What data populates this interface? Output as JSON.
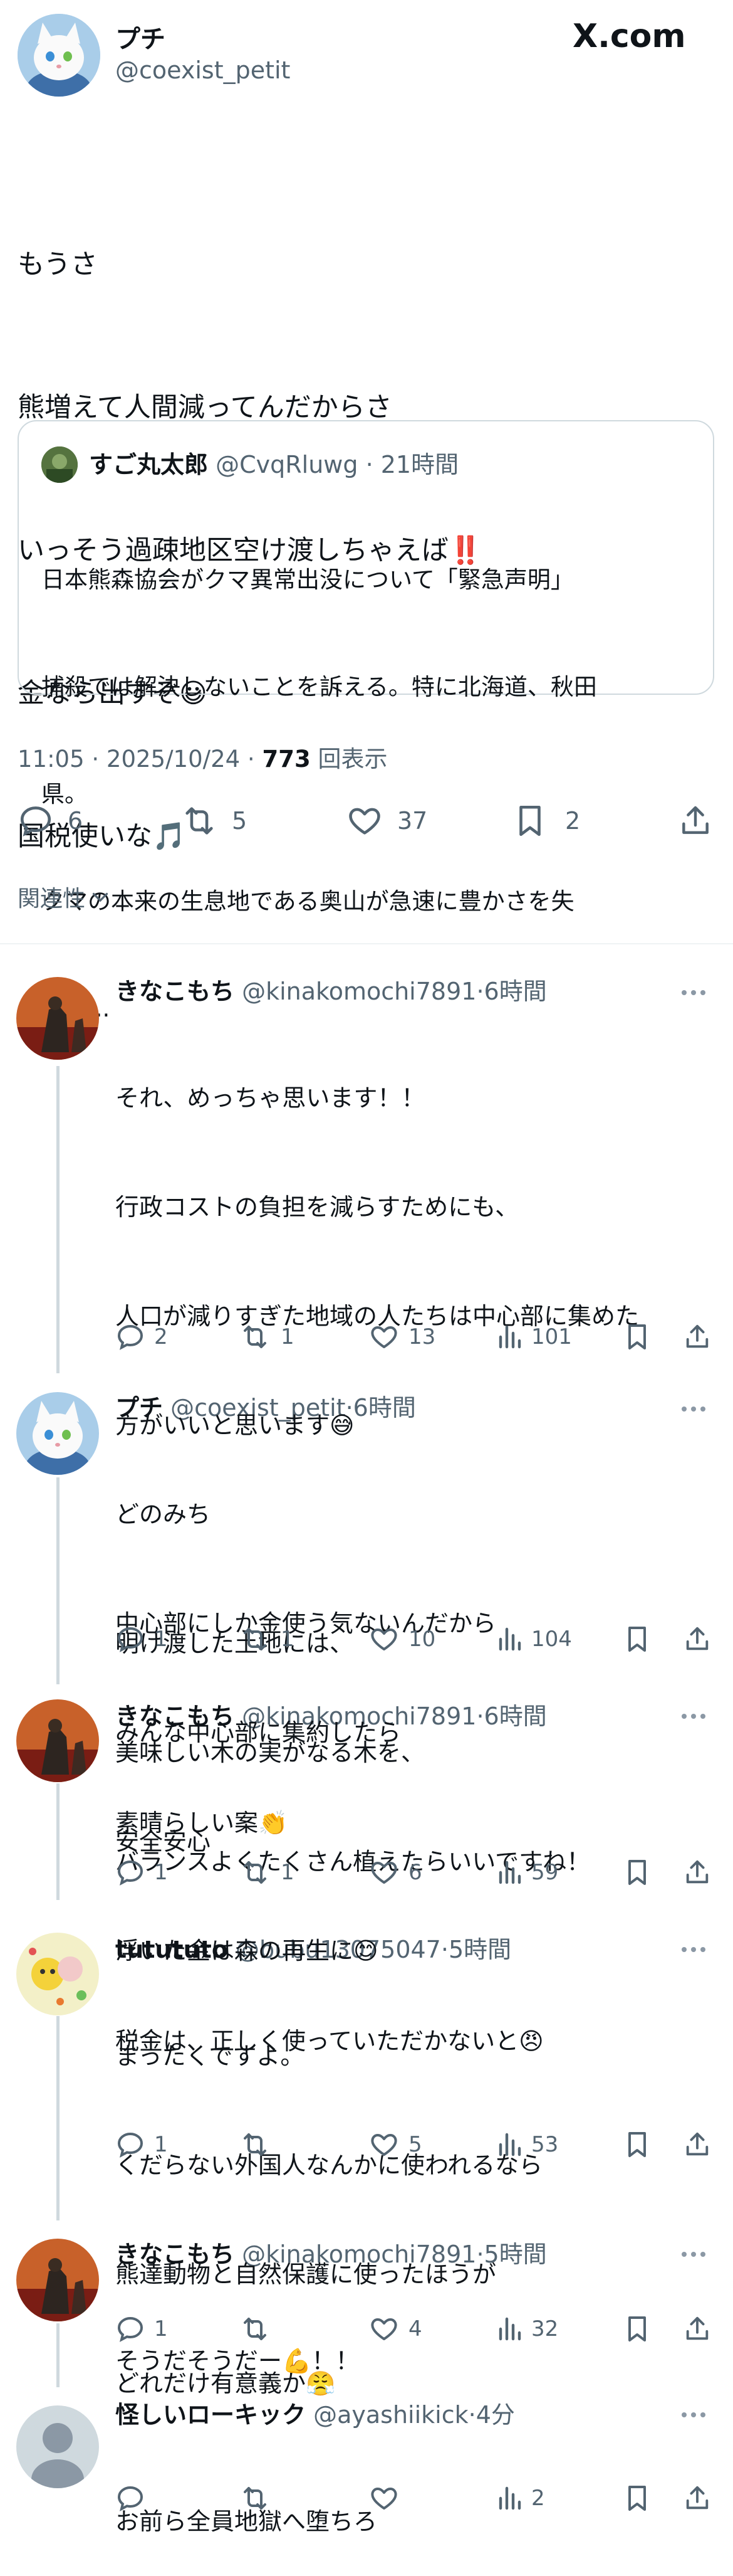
{
  "main_tweet": {
    "author_name": "プチ",
    "author_handle": "@coexist_petit",
    "logo_text": "X.com",
    "lines": [
      "もうさ",
      "熊増えて人間減ってんだからさ",
      "いっそう過疎地区空け渡しちゃえば‼️",
      "金なら出すぞ😃",
      "国税使いな🎵"
    ],
    "quote": {
      "author_name": "すご丸太郎",
      "author_handle": "@CvqRluwg",
      "time": "21時間",
      "lines": [
        "日本熊森協会がクマ異常出没について「緊急声明」",
        "捕殺では解決しないことを訴える。特に北海道、秋田",
        "県。",
        "クマの本来の生息地である奥山が急速に豊かさを失",
        "い、..."
      ]
    },
    "timestamp": "11:05 · 2025/10/24 · ",
    "views_count": "773",
    "views_label": "回表示",
    "stats": {
      "replies": "6",
      "retweets": "5",
      "likes": "37",
      "bookmarks": "2"
    }
  },
  "sort_label": "関連性",
  "replies": [
    {
      "author_name": "きなこもち",
      "author_handle": "@kinakomochi7891",
      "time": "6時間",
      "lines": [
        "それ、めっちゃ思います！！",
        "行政コストの負担を減らすためにも、",
        "人口が減りすぎた地域の人たちは中心部に集めた",
        "方がいいと思います😅",
        "",
        "明け渡した土地には、",
        "美味しい木の実がなる木を、",
        "バランスよくたくさん植えたらいいですね！"
      ],
      "stats": {
        "replies": "2",
        "retweets": "1",
        "likes": "13",
        "views": "101"
      }
    },
    {
      "author_name": "プチ",
      "author_handle": "@coexist_petit",
      "time": "6時間",
      "lines": [
        "どのみち",
        "中心部にしか金使う気ないんだから",
        "みんな中心部に集約したら",
        "安全安心",
        "浮いた金は森の再生に😊"
      ],
      "stats": {
        "replies": "1",
        "retweets": "1",
        "likes": "10",
        "views": "104"
      }
    },
    {
      "author_name": "きなこもち",
      "author_handle": "@kinakomochi7891",
      "time": "6時間",
      "lines": [
        "素晴らしい案👏",
        "",
        "税金は、正しく使っていただかないと😠"
      ],
      "stats": {
        "replies": "1",
        "retweets": "1",
        "likes": "6",
        "views": "59"
      }
    },
    {
      "author_name": "tutututo",
      "author_handle": "@bubu13075047",
      "time": "5時間",
      "lines": [
        "まったくですよ。",
        "くだらない外国人なんかに使われるなら",
        "熊達動物と自然保護に使ったほうが",
        "どれだけ有意義か😤"
      ],
      "stats": {
        "replies": "1",
        "retweets": "",
        "likes": "5",
        "views": "53"
      }
    },
    {
      "author_name": "きなこもち",
      "author_handle": "@kinakomochi7891",
      "time": "5時間",
      "lines": [
        "そうだそうだー💪！！"
      ],
      "stats": {
        "replies": "1",
        "retweets": "",
        "likes": "4",
        "views": "32"
      }
    },
    {
      "author_name": "怪しいローキック",
      "author_handle": "@ayashiikick",
      "time": "4分",
      "lines": [
        "お前ら全員地獄へ堕ちろ"
      ],
      "stats": {
        "replies": "",
        "retweets": "",
        "likes": "",
        "views": "2"
      }
    }
  ]
}
